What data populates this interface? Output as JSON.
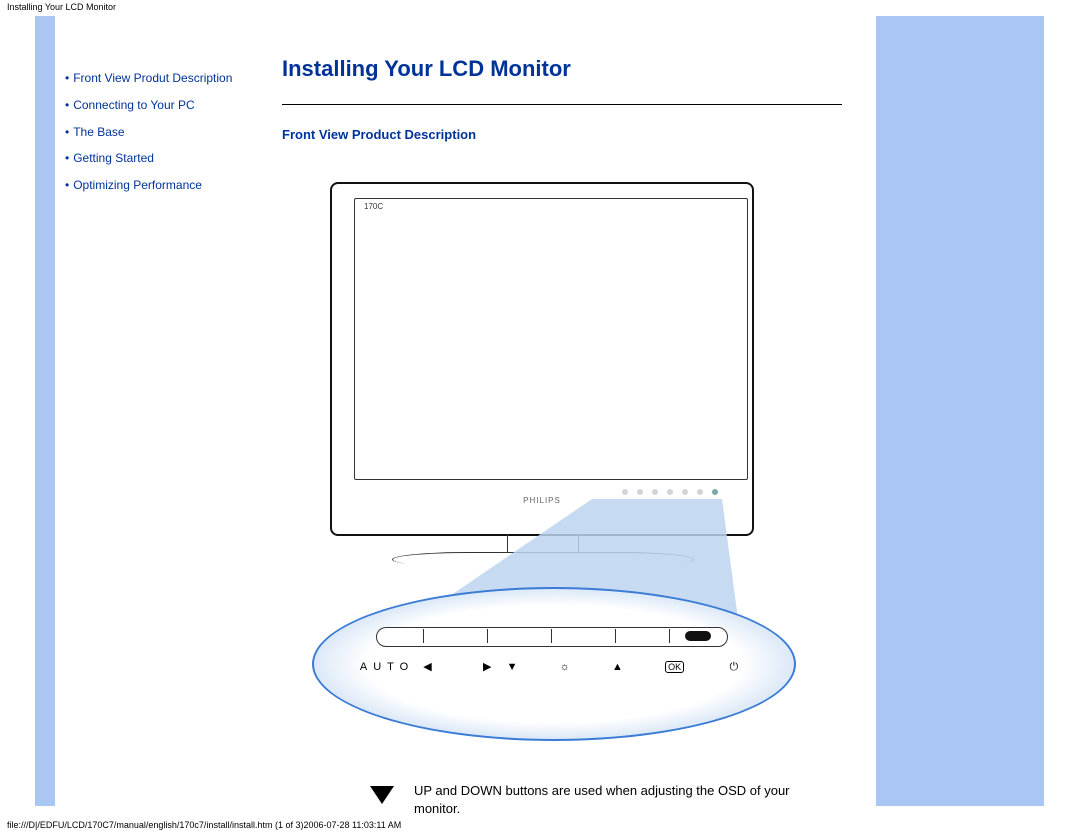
{
  "header": {
    "tab": "Installing Your LCD Monitor"
  },
  "nav": [
    "Front View Produt Description",
    "Connecting to Your PC",
    "The Base",
    "Getting Started",
    "Optimizing Performance"
  ],
  "main": {
    "title": "Installing Your LCD Monitor",
    "section": "Front View Product Description"
  },
  "figure": {
    "model": "170C",
    "brand": "PHILIPS",
    "buttons": [
      "AUTO"
    ],
    "description": "UP and DOWN buttons are used when adjusting the OSD of your monitor."
  },
  "footer": {
    "path": "file:///D|/EDFU/LCD/170C7/manual/english/170c7/install/install.htm (1 of 3)2006-07-28 11:03:11 AM"
  }
}
